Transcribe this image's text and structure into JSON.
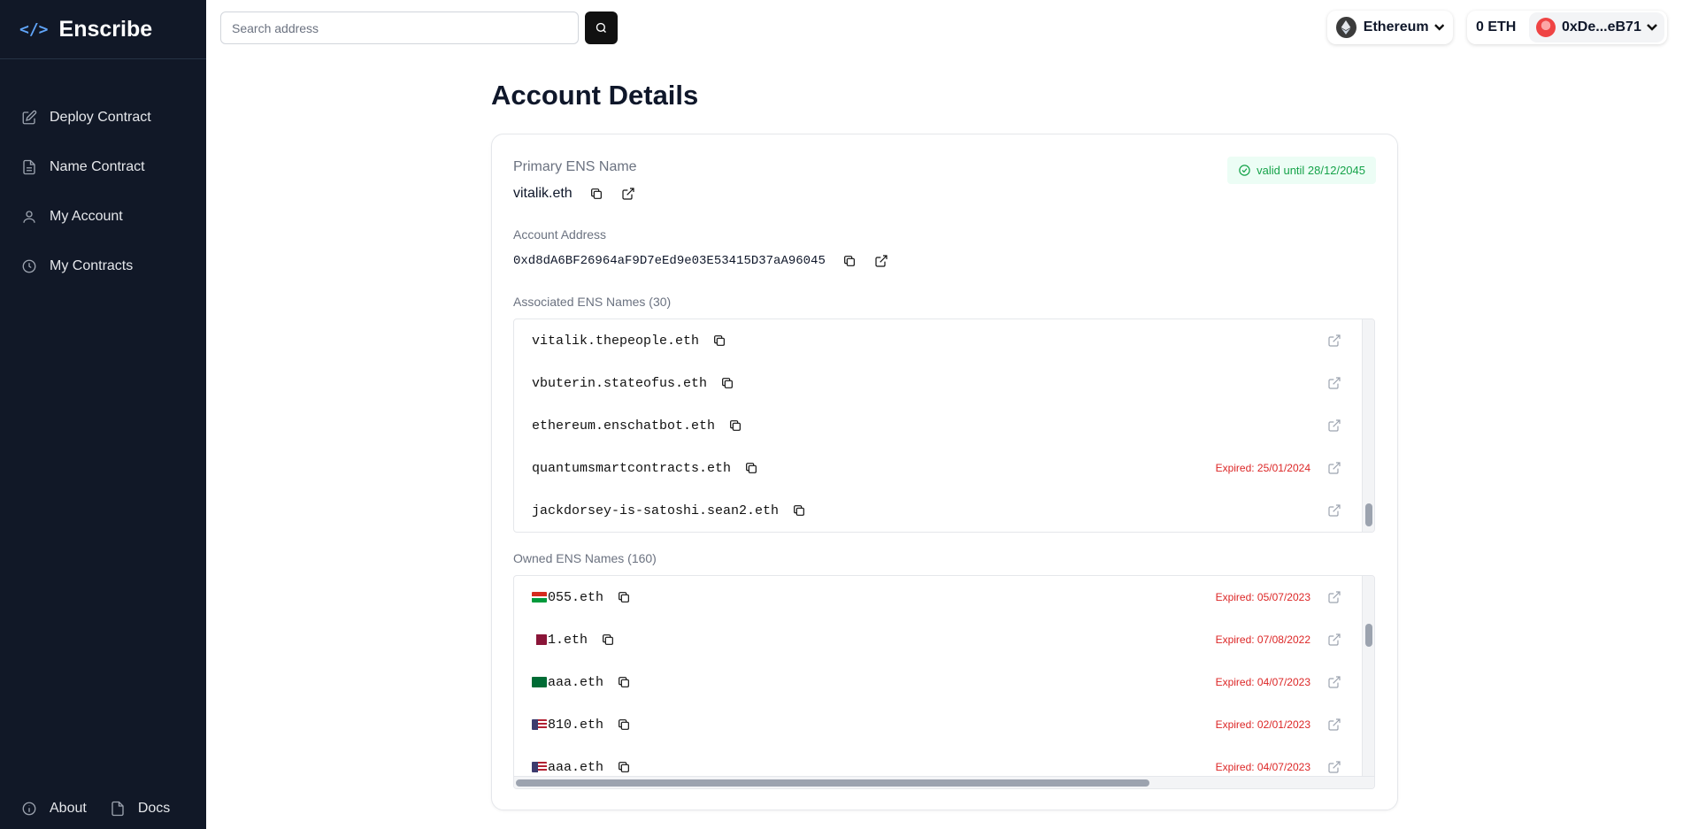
{
  "app": {
    "name": "Enscribe",
    "logo_glyph": "</>"
  },
  "sidebar": {
    "items": [
      {
        "label": "Deploy Contract",
        "icon": "edit-icon"
      },
      {
        "label": "Name Contract",
        "icon": "document-icon"
      },
      {
        "label": "My Account",
        "icon": "user-icon"
      },
      {
        "label": "My Contracts",
        "icon": "clock-icon"
      }
    ],
    "footer": [
      {
        "label": "About",
        "icon": "info-icon"
      },
      {
        "label": "Docs",
        "icon": "document-icon"
      }
    ]
  },
  "search": {
    "placeholder": "Search address",
    "value": ""
  },
  "network": {
    "name": "Ethereum"
  },
  "wallet": {
    "balance": "0 ETH",
    "address": "0xDe...eB71"
  },
  "page": {
    "title": "Account Details"
  },
  "primary": {
    "label": "Primary ENS Name",
    "name": "vitalik.eth",
    "valid_badge": "valid until 28/12/2045"
  },
  "account": {
    "label": "Account Address",
    "address": "0xd8dA6BF26964aF9D7eEd9e03E53415D37aA96045"
  },
  "associated": {
    "label": "Associated ENS Names (30)",
    "items": [
      {
        "name": "vitalik.thepeople.eth",
        "expired": ""
      },
      {
        "name": "vbuterin.stateofus.eth",
        "expired": ""
      },
      {
        "name": "ethereum.enschatbot.eth",
        "expired": ""
      },
      {
        "name": "quantumsmartcontracts.eth",
        "expired": "Expired: 25/01/2024"
      },
      {
        "name": "jackdorsey-is-satoshi.sean2.eth",
        "expired": ""
      }
    ]
  },
  "owned": {
    "label": "Owned ENS Names (160)",
    "items": [
      {
        "flag": "oman",
        "name": "055.eth",
        "expired": "Expired: 05/07/2023"
      },
      {
        "flag": "qatar",
        "name": "1.eth",
        "expired": "Expired: 07/08/2022"
      },
      {
        "flag": "saudi",
        "name": "aaa.eth",
        "expired": "Expired: 04/07/2023"
      },
      {
        "flag": "usa",
        "name": "810.eth",
        "expired": "Expired: 02/01/2023"
      },
      {
        "flag": "usa",
        "name": "aaa.eth",
        "expired": "Expired: 04/07/2023"
      }
    ]
  }
}
